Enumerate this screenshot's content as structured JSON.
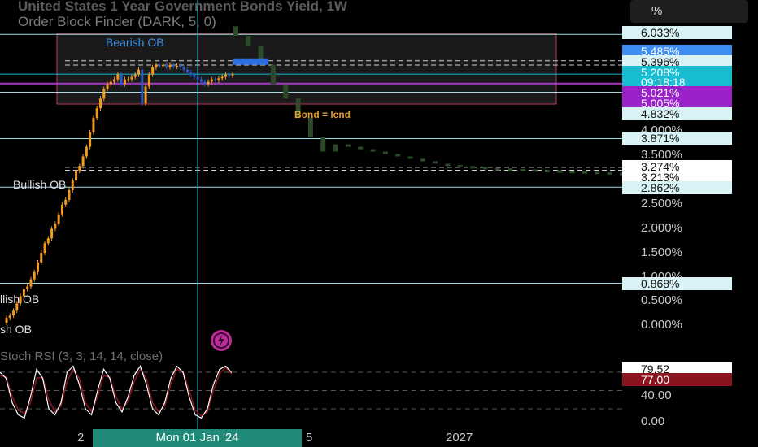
{
  "header": {
    "title": "United States 1 Year Government Bonds Yield, 1W",
    "subtitle": "Order Block Finder (DARK, 5, 0)",
    "percent_button": "%"
  },
  "annotations": {
    "bond_label": "Bond = lend",
    "bearish_ob": "Bearish OB",
    "bullish_ob_1": "Bullish OB",
    "bullish_ob_2": "llish OB",
    "bullish_ob_3": "sh OB"
  },
  "indicator": {
    "label": "Stoch RSI (3, 3, 14, 14, close)"
  },
  "price_axis": {
    "ticks": [
      "4.000%",
      "3.500%",
      "2.500%",
      "2.000%",
      "1.500%",
      "1.000%",
      "0.500%",
      "0.000%"
    ]
  },
  "price_tags": [
    {
      "text": "6.033%",
      "bg": "#d8f2f5",
      "fg": "#111111"
    },
    {
      "text": "5.485%",
      "bg": "#3d8ef0",
      "fg": "#ffffff"
    },
    {
      "text": "5.396%",
      "bg": "#d8f2f5",
      "fg": "#111111"
    },
    {
      "text": "5.208%",
      "bg": "#17bcd0",
      "fg": "#ffffff"
    },
    {
      "text": "09:18:18",
      "bg": "#17bcd0",
      "fg": "#ffffff"
    },
    {
      "text": "5.021%",
      "bg": "#9b22c9",
      "fg": "#ffffff"
    },
    {
      "text": "5.005%",
      "bg": "#9b22c9",
      "fg": "#ffffff"
    },
    {
      "text": "4.832%",
      "bg": "#d8f2f5",
      "fg": "#111111"
    },
    {
      "text": "3.871%",
      "bg": "#d8f2f5",
      "fg": "#111111"
    },
    {
      "text": "3.274%",
      "bg": "#ffffff",
      "fg": "#111111"
    },
    {
      "text": "3.213%",
      "bg": "#ffffff",
      "fg": "#111111"
    },
    {
      "text": "2.862%",
      "bg": "#d8f2f5",
      "fg": "#111111"
    },
    {
      "text": "0.868%",
      "bg": "#d8f2f5",
      "fg": "#111111"
    }
  ],
  "rsi_axis": {
    "ticks": [
      "40.00",
      "0.00"
    ],
    "tags": [
      {
        "text": "79.52",
        "bg": "#ffffff",
        "fg": "#111111"
      },
      {
        "text": "77.00",
        "bg": "#8a1420",
        "fg": "#ffffff"
      }
    ]
  },
  "time_axis": {
    "crosshair_label": "Mon 01 Jan '24",
    "labels": [
      "2",
      "5",
      "2027"
    ]
  },
  "colors": {
    "up": "#f29a1f",
    "down": "#2a58c8",
    "forecast": "#2c4a2a",
    "ob_box_border": "#b83a5a",
    "crosshair": "#17bcd0",
    "stoch_k": "#ffffff",
    "stoch_d": "#8a1420"
  },
  "chart_data": {
    "type": "candlestick",
    "y_unit": "%",
    "y_range": [
      0,
      6.1
    ],
    "x_range": [
      "2021",
      "2027"
    ],
    "crosshair_date": "Mon 01 Jan '24",
    "price_levels": [
      6.033,
      5.485,
      5.396,
      5.208,
      5.021,
      5.005,
      4.832,
      3.871,
      3.274,
      3.213,
      2.862,
      0.868
    ],
    "history_close": [
      0.15,
      0.2,
      0.3,
      0.45,
      0.6,
      0.75,
      0.8,
      0.95,
      1.1,
      1.3,
      1.5,
      1.7,
      1.8,
      2.0,
      2.1,
      2.3,
      2.5,
      2.6,
      2.8,
      3.0,
      3.2,
      3.3,
      3.5,
      3.7,
      4.0,
      4.3,
      4.5,
      4.7,
      4.9,
      5.0,
      5.05,
      5.1,
      5.2,
      5.0,
      5.1,
      5.1,
      5.15,
      5.2,
      5.3,
      4.6,
      4.95,
      5.2,
      5.35,
      5.4,
      5.38,
      5.4,
      5.35,
      5.4,
      5.36,
      5.38,
      5.35,
      5.3,
      5.25,
      5.2,
      5.15,
      5.1,
      5.05,
      5.0,
      5.05,
      5.1,
      5.08,
      5.12,
      5.15,
      5.2,
      5.18,
      5.21
    ],
    "forecast_close": [
      6.0,
      5.8,
      5.4,
      5.0,
      4.7,
      4.3,
      3.9,
      3.6,
      3.75,
      3.7,
      3.65,
      3.6,
      3.55,
      3.5,
      3.45,
      3.4,
      3.35,
      3.32,
      3.3,
      3.28,
      3.26,
      3.25,
      3.24,
      3.23,
      3.22,
      3.21,
      3.2,
      3.19,
      3.18,
      3.17,
      3.16,
      3.15
    ],
    "stoch_rsi_k": [
      80,
      70,
      30,
      10,
      5,
      40,
      85,
      70,
      20,
      10,
      30,
      80,
      90,
      60,
      20,
      10,
      50,
      85,
      70,
      30,
      15,
      40,
      75,
      90,
      60,
      20,
      10,
      30,
      70,
      90,
      80,
      40,
      10,
      5,
      20,
      60,
      85,
      90,
      79.52
    ],
    "stoch_rsi_d": [
      75,
      72,
      40,
      18,
      12,
      30,
      70,
      72,
      35,
      15,
      25,
      65,
      85,
      70,
      30,
      15,
      40,
      75,
      72,
      40,
      20,
      32,
      65,
      85,
      70,
      30,
      15,
      25,
      60,
      85,
      82,
      50,
      18,
      8,
      15,
      50,
      78,
      88,
      77.0
    ],
    "stoch_rsi_range": [
      0,
      100
    ]
  }
}
